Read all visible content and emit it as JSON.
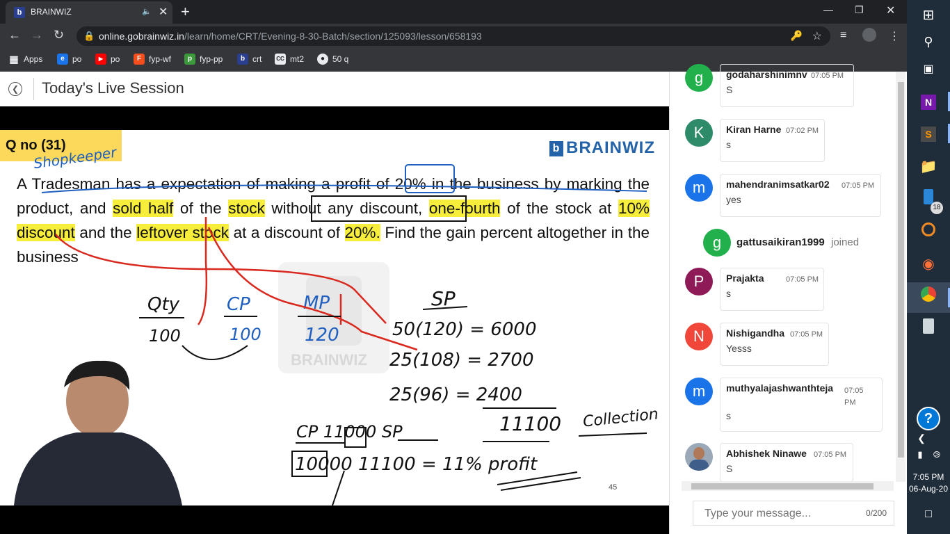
{
  "browser": {
    "tab_title": "BRAINWIZ",
    "new_tab": "+",
    "url_domain": "online.gobrainwiz.in",
    "url_path": "/learn/home/CRT/Evening-8-30-Batch/section/125093/lesson/658193",
    "bookmarks": [
      {
        "label": "Apps",
        "icon": "apps-grid-icon"
      },
      {
        "label": "po",
        "icon": "edge-icon"
      },
      {
        "label": "po",
        "icon": "youtube-icon"
      },
      {
        "label": "fyp-wf",
        "icon": "figma-icon"
      },
      {
        "label": "fyp-pp",
        "icon": "image-icon"
      },
      {
        "label": "crt",
        "icon": "brainwiz-icon"
      },
      {
        "label": "mt2",
        "icon": "cc-icon"
      },
      {
        "label": "50 q",
        "icon": "globe-icon"
      }
    ]
  },
  "page": {
    "title": "Today's Live Session"
  },
  "slide": {
    "qno": "Q no (31)",
    "brand": "BRAINWIZ",
    "question_parts": [
      {
        "t": "A Tradesman has a expectation of making a profit of ",
        "hl": false
      },
      {
        "t": "20%",
        "hl": false
      },
      {
        "t": " in the business by marking the product, and ",
        "hl": false
      },
      {
        "t": "sold half",
        "hl": true
      },
      {
        "t": " of the ",
        "hl": false
      },
      {
        "t": "stock",
        "hl": true
      },
      {
        "t": " without any discount, ",
        "hl": false
      },
      {
        "t": "one-fourth",
        "hl": true
      },
      {
        "t": " of the stock at ",
        "hl": false
      },
      {
        "t": "10% discount",
        "hl": true
      },
      {
        "t": " and the ",
        "hl": false
      },
      {
        "t": "leftover stock",
        "hl": true
      },
      {
        "t": " at a discount of ",
        "hl": false
      },
      {
        "t": "20%.",
        "hl": true
      },
      {
        "t": " Find the gain percent altogether in the business",
        "hl": false
      }
    ],
    "handwriting": {
      "shopkeeper": "Shopkeeper",
      "qty": "Qty",
      "qty_val": "100",
      "cp": "CP",
      "cp_val": "100",
      "mp": "MP",
      "mp_val": "120",
      "sp": "SP",
      "row1": "50(120) = 6000",
      "row2": "25(108) = 2700",
      "row3": "25(96) = 2400",
      "total": "11100",
      "collection": "Collection",
      "cp_sp": "CP   11000   SP",
      "result": "10000   11100 = 11% profit"
    },
    "watermark": "BRAINWIZ",
    "page_number": "45"
  },
  "chat": {
    "messages": [
      {
        "name": "godaharshinimnv",
        "time": "07:05 PM",
        "text": "S",
        "avatar": "g",
        "color": "#22b04c"
      },
      {
        "name": "Kiran Harne",
        "time": "07:02 PM",
        "text": "s",
        "avatar": "K",
        "color": "#2e8b69"
      },
      {
        "name": "mahendranimsatkar02",
        "time": "07:05 PM",
        "text": "yes",
        "avatar": "m",
        "color": "#1a73e8"
      },
      {
        "name": "Prajakta",
        "time": "07:05 PM",
        "text": "s",
        "avatar": "P",
        "color": "#8e1b57"
      },
      {
        "name": "Nishigandha",
        "time": "07:05 PM",
        "text": "Yesss",
        "avatar": "N",
        "color": "#f0473a"
      },
      {
        "name": "muthyalajashwanthteja",
        "time": "07:05 PM",
        "text": "s",
        "avatar": "m",
        "color": "#1a73e8"
      },
      {
        "name": "Abhishek Ninawe",
        "time": "07:05 PM",
        "text": "S",
        "avatar": "photo",
        "color": "#9aa8b8"
      }
    ],
    "join": {
      "name": "gattusaikiran1999",
      "action": "joined",
      "avatar": "g"
    },
    "input_placeholder": "Type your message...",
    "char_count": "0/200"
  },
  "taskbar": {
    "badge": "18",
    "time": "7:05 PM",
    "date": "06-Aug-20"
  }
}
